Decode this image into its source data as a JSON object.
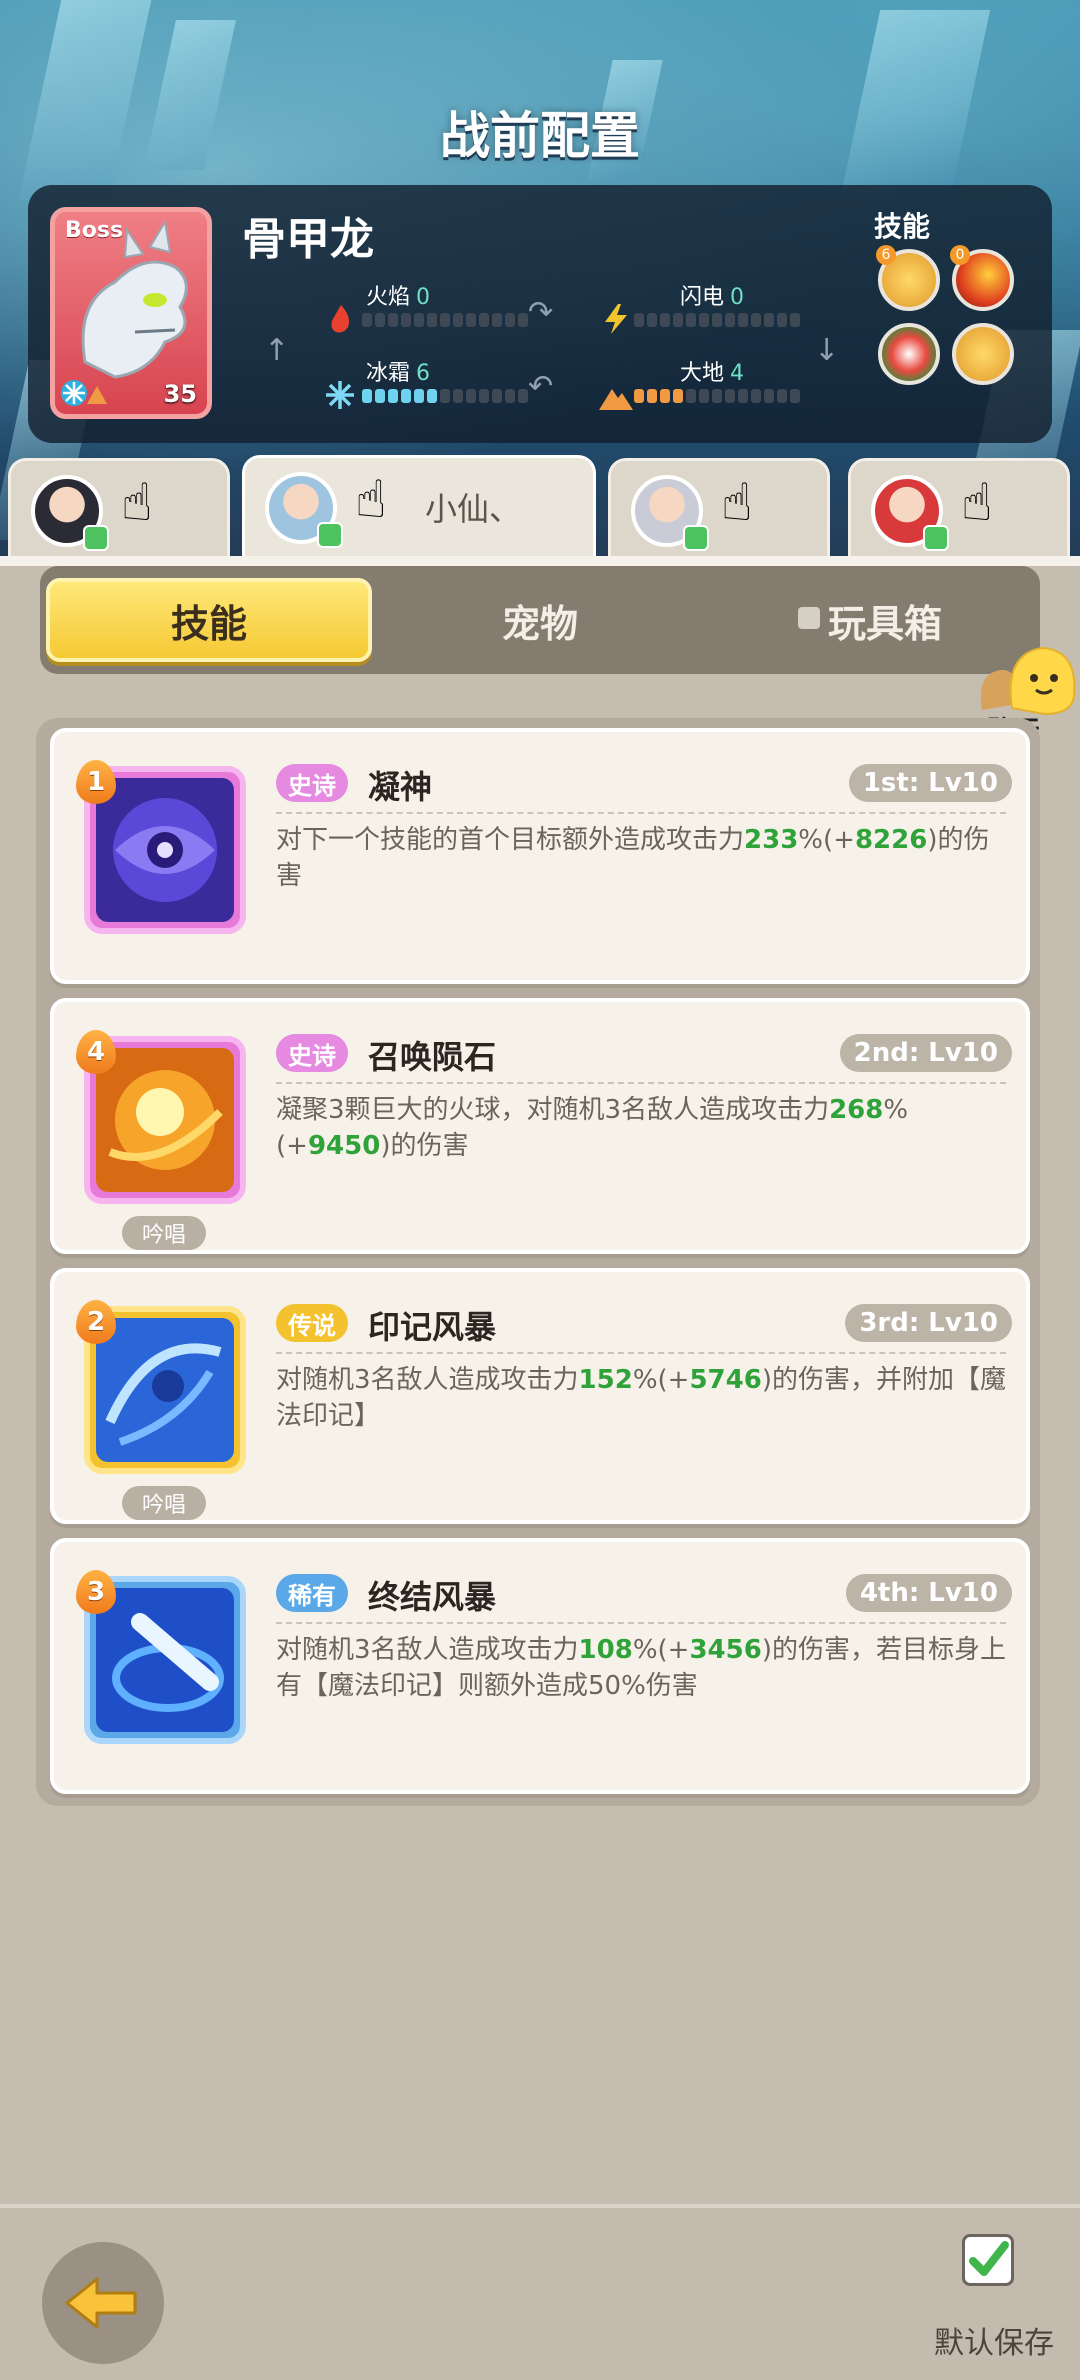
{
  "header": {
    "title": "战前配置"
  },
  "boss": {
    "tag": "Boss",
    "name": "骨甲龙",
    "level": "35",
    "elements": [
      {
        "name": "火焰",
        "value": "0",
        "filled": 0
      },
      {
        "name": "闪电",
        "value": "0",
        "filled": 0
      },
      {
        "name": "冰霜",
        "value": "6",
        "filled": 6
      },
      {
        "name": "大地",
        "value": "4",
        "filled": 4
      }
    ],
    "skills_label": "技能",
    "skill_badges": [
      "6",
      "0"
    ]
  },
  "heroes": [
    {
      "name": "",
      "active": false
    },
    {
      "name": "小仙、",
      "active": true
    },
    {
      "name": "",
      "active": false
    },
    {
      "name": "",
      "active": false
    }
  ],
  "tabs": {
    "skills": "技能",
    "pets": "宠物",
    "toybox": "玩具箱"
  },
  "chat": {
    "label": "聊天"
  },
  "skills": [
    {
      "rank": "1",
      "rarity": "史诗",
      "rarity_color": "#e58ae0",
      "name": "凝神",
      "slot": "1st: Lv10",
      "desc_before": "对下一个技能的首个目标额外造成攻击力",
      "pct": "233",
      "paren_open": "%(+",
      "bonus": "8226",
      "desc_after": ")的伤害",
      "chant": ""
    },
    {
      "rank": "4",
      "rarity": "史诗",
      "rarity_color": "#e58ae0",
      "name": "召唤陨石",
      "slot": "2nd: Lv10",
      "desc_before": "凝聚3颗巨大的火球，对随机3名敌人造成攻击力",
      "pct": "268",
      "paren_open": "%(+",
      "bonus": "9450",
      "desc_after": ")的伤害",
      "chant": "吟唱"
    },
    {
      "rank": "2",
      "rarity": "传说",
      "rarity_color": "#f4c22e",
      "name": "印记风暴",
      "slot": "3rd: Lv10",
      "desc_before": "对随机3名敌人造成攻击力",
      "pct": "152",
      "paren_open": "%(+",
      "bonus": "5746",
      "desc_after": ")的伤害，并附加【魔法印记】",
      "chant": "吟唱"
    },
    {
      "rank": "3",
      "rarity": "稀有",
      "rarity_color": "#5aa8e8",
      "name": "终结风暴",
      "slot": "4th: Lv10",
      "desc_before": "对随机3名敌人造成攻击力",
      "pct": "108",
      "paren_open": "%(+",
      "bonus": "3456",
      "desc_after": ")的伤害，若目标身上有【魔法印记】则额外造成50%伤害",
      "chant": ""
    }
  ],
  "footer": {
    "save_label": "默认保存"
  }
}
